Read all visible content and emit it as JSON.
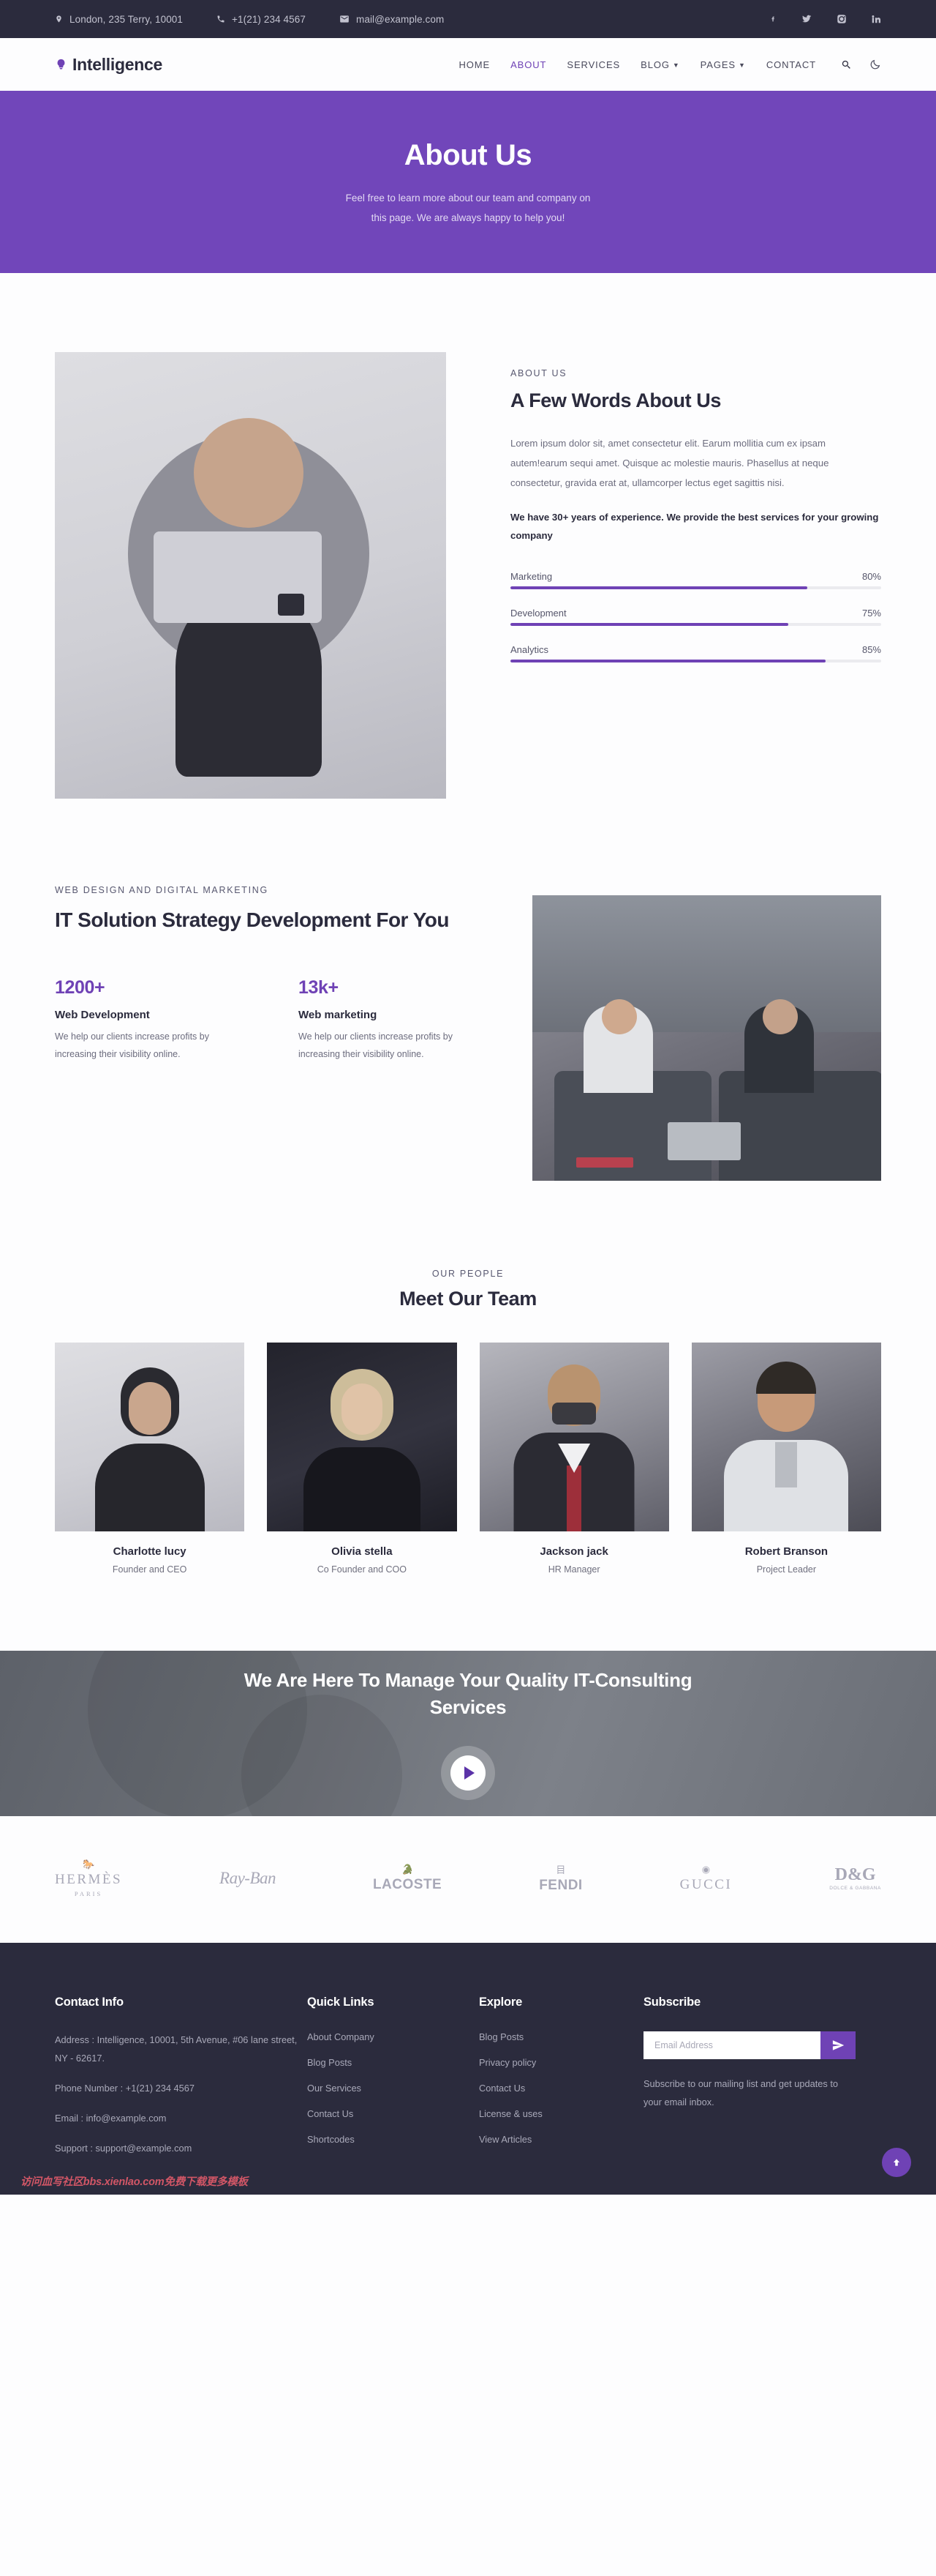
{
  "topbar": {
    "address": "London, 235 Terry, 10001",
    "phone": "+1(21) 234 4567",
    "email": "mail@example.com",
    "socials": [
      {
        "name": "facebook-icon",
        "label": "f"
      },
      {
        "name": "twitter-icon",
        "label": "t"
      },
      {
        "name": "instagram-icon",
        "label": "ig"
      },
      {
        "name": "linkedin-icon",
        "label": "in"
      }
    ]
  },
  "header": {
    "brand": "Intelligence",
    "nav": [
      {
        "label": "HOME",
        "active": false,
        "caret": false
      },
      {
        "label": "ABOUT",
        "active": true,
        "caret": false
      },
      {
        "label": "SERVICES",
        "active": false,
        "caret": false
      },
      {
        "label": "BLOG",
        "active": false,
        "caret": true
      },
      {
        "label": "PAGES",
        "active": false,
        "caret": true
      },
      {
        "label": "CONTACT",
        "active": false,
        "caret": false
      }
    ],
    "search_icon": "search-icon",
    "theme_icon": "moon-icon"
  },
  "hero": {
    "title": "About Us",
    "subtitle": "Feel free to learn more about our team and company on this page. We are always happy to help you!"
  },
  "about": {
    "eyebrow": "ABOUT US",
    "title": "A Few Words About Us",
    "paragraph": "Lorem ipsum dolor sit, amet consectetur elit. Earum mollitia cum ex ipsam autem!earum sequi amet. Quisque ac molestie mauris. Phasellus at neque consectetur, gravida erat at, ullamcorper lectus eget sagittis nisi.",
    "highlight": "We have 30+ years of experience. We provide the best services for your growing company",
    "skills": [
      {
        "label": "Marketing",
        "percent": "80%",
        "value": 80
      },
      {
        "label": "Development",
        "percent": "75%",
        "value": 75
      },
      {
        "label": "Analytics",
        "percent": "85%",
        "value": 85
      }
    ]
  },
  "itsolution": {
    "eyebrow": "WEB DESIGN AND DIGITAL MARKETING",
    "title": "IT Solution Strategy Development For You",
    "stats": [
      {
        "number": "1200+",
        "title": "Web Development",
        "desc": "We help our clients increase profits by increasing their visibility online."
      },
      {
        "number": "13k+",
        "title": "Web marketing",
        "desc": "We help our clients increase profits by increasing their visibility online."
      }
    ]
  },
  "team": {
    "eyebrow": "OUR PEOPLE",
    "title": "Meet Our Team",
    "members": [
      {
        "name": "Charlotte lucy",
        "role": "Founder and CEO"
      },
      {
        "name": "Olivia stella",
        "role": "Co Founder and COO"
      },
      {
        "name": "Jackson jack",
        "role": "HR Manager"
      },
      {
        "name": "Robert Branson",
        "role": "Project Leader"
      }
    ]
  },
  "cta": {
    "title": "We Are Here To Manage Your Quality IT-Consulting Services",
    "play_icon": "play-icon"
  },
  "brands": [
    {
      "name": "HERMÈS",
      "sub": "PARIS",
      "style": "serif"
    },
    {
      "name": "Ray-Ban",
      "sub": "",
      "style": "script"
    },
    {
      "name": "LACOSTE",
      "sub": "",
      "style": "bold"
    },
    {
      "name": "FENDI",
      "sub": "",
      "style": "bold"
    },
    {
      "name": "GUCCI",
      "sub": "",
      "style": "serif"
    },
    {
      "name": "D&G",
      "sub": "DOLCE & GABBANA",
      "style": "dg"
    }
  ],
  "footer": {
    "contact": {
      "heading": "Contact Info",
      "lines": [
        "Address : Intelligence, 10001, 5th Avenue, #06 lane street, NY - 62617.",
        "Phone Number : +1(21) 234 4567",
        "Email : info@example.com",
        "Support : support@example.com"
      ]
    },
    "quick": {
      "heading": "Quick Links",
      "links": [
        "About Company",
        "Blog Posts",
        "Our Services",
        "Contact Us",
        "Shortcodes"
      ]
    },
    "explore": {
      "heading": "Explore",
      "links": [
        "Blog Posts",
        "Privacy policy",
        "Contact Us",
        "License & uses",
        "View Articles"
      ]
    },
    "subscribe": {
      "heading": "Subscribe",
      "placeholder": "Email Address",
      "value": "",
      "note": "Subscribe to our mailing list and get updates to your email inbox.",
      "send_icon": "send-icon"
    },
    "scrolltop_icon": "arrow-up-icon",
    "watermark": "访问血写社区bbs.xienlao.com免费下载更多模板"
  },
  "colors": {
    "accent": "#6f42b5",
    "hero": "#7146ba",
    "dark": "#2b2b3d"
  }
}
